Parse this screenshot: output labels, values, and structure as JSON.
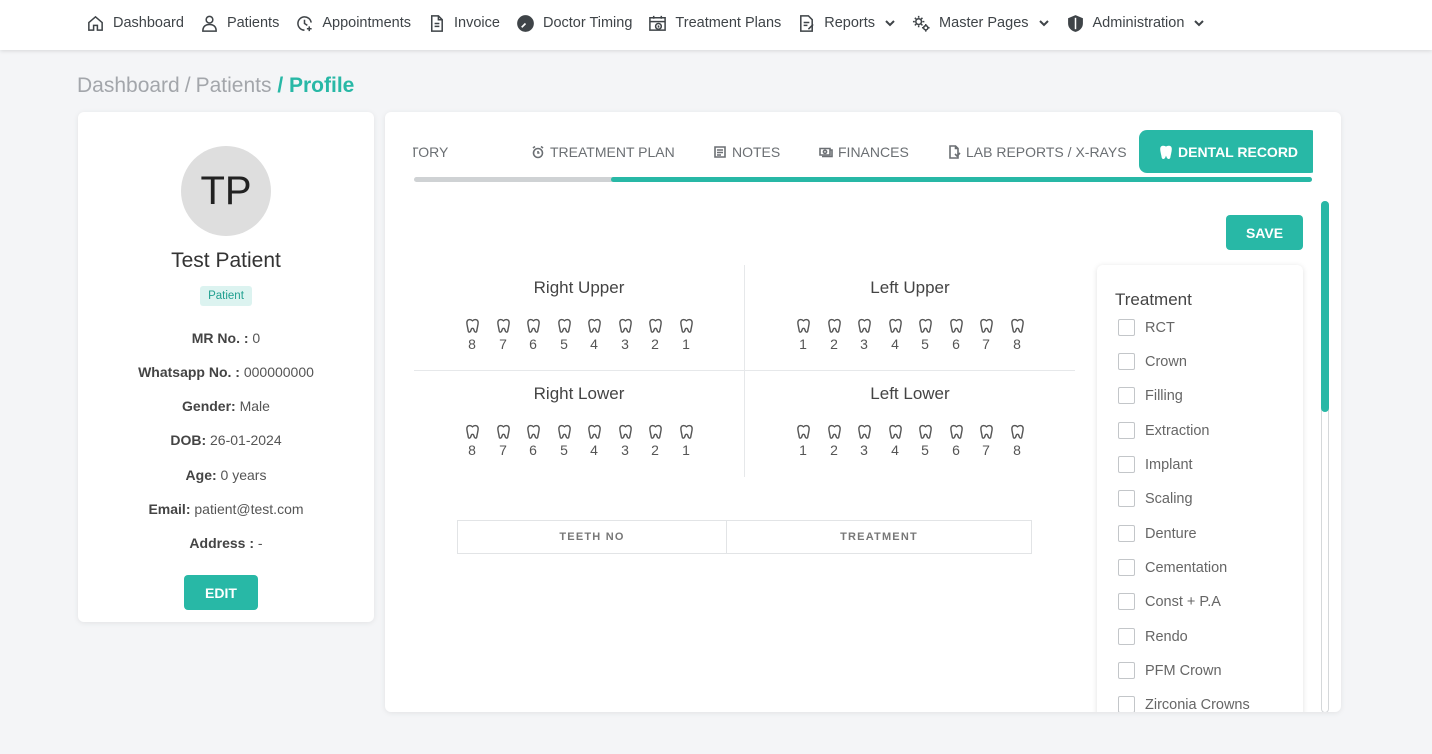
{
  "nav": [
    {
      "id": "dashboard",
      "label": "Dashboard",
      "icon": "home-icon",
      "dropdown": false
    },
    {
      "id": "patients",
      "label": "Patients",
      "icon": "user-icon",
      "dropdown": false
    },
    {
      "id": "appointments",
      "label": "Appointments",
      "icon": "clock-plus-icon",
      "dropdown": false
    },
    {
      "id": "invoice",
      "label": "Invoice",
      "icon": "document-icon",
      "dropdown": false
    },
    {
      "id": "doctor-timing",
      "label": "Doctor Timing",
      "icon": "timer-icon",
      "dropdown": false
    },
    {
      "id": "treatment-plans",
      "label": "Treatment Plans",
      "icon": "calendar-clock-icon",
      "dropdown": false
    },
    {
      "id": "reports",
      "label": "Reports",
      "icon": "report-icon",
      "dropdown": true
    },
    {
      "id": "master-pages",
      "label": "Master Pages",
      "icon": "gears-icon",
      "dropdown": true
    },
    {
      "id": "administration",
      "label": "Administration",
      "icon": "shield-icon",
      "dropdown": true
    }
  ],
  "breadcrumb": {
    "part1": "Dashboard",
    "part2": "Patients",
    "current": "Profile",
    "sep": "/"
  },
  "profile": {
    "initials": "TP",
    "name": "Test Patient",
    "badge": "Patient",
    "fields": [
      {
        "label": "MR No. :",
        "value": "0"
      },
      {
        "label": "Whatsapp No. :",
        "value": "000000000"
      },
      {
        "label": "Gender:",
        "value": "Male"
      },
      {
        "label": "DOB:",
        "value": "26-01-2024"
      },
      {
        "label": "Age:",
        "value": "0 years"
      },
      {
        "label": "Email:",
        "value": "patient@test.com"
      },
      {
        "label": "Address :",
        "value": "-"
      }
    ],
    "edit_label": "EDIT"
  },
  "tabs": {
    "medical_history": "MEDICAL HISTORY",
    "treatment_plan": "TREATMENT PLAN",
    "notes": "NOTES",
    "finances": "FINANCES",
    "lab_reports": "LAB REPORTS / X-RAYS",
    "dental_record": "DENTAL RECORD",
    "active": "dental_record"
  },
  "save_label": "SAVE",
  "teeth": {
    "right_upper": {
      "title": "Right Upper",
      "numbers": [
        "8",
        "7",
        "6",
        "5",
        "4",
        "3",
        "2",
        "1"
      ]
    },
    "left_upper": {
      "title": "Left Upper",
      "numbers": [
        "1",
        "2",
        "3",
        "4",
        "5",
        "6",
        "7",
        "8"
      ]
    },
    "right_lower": {
      "title": "Right Lower",
      "numbers": [
        "8",
        "7",
        "6",
        "5",
        "4",
        "3",
        "2",
        "1"
      ]
    },
    "left_lower": {
      "title": "Left Lower",
      "numbers": [
        "1",
        "2",
        "3",
        "4",
        "5",
        "6",
        "7",
        "8"
      ]
    }
  },
  "table": {
    "col_teeth": "TEETH NO",
    "col_treatment": "TREATMENT"
  },
  "treatment_panel": {
    "title": "Treatment",
    "options": [
      "RCT",
      "Crown",
      "Filling",
      "Extraction",
      "Implant",
      "Scaling",
      "Denture",
      "Cementation",
      "Const + P.A",
      "Rendo",
      "PFM Crown",
      "Zirconia Crowns"
    ]
  },
  "colors": {
    "accent": "#28b8a6",
    "badge_bg": "#dcf3f0"
  }
}
